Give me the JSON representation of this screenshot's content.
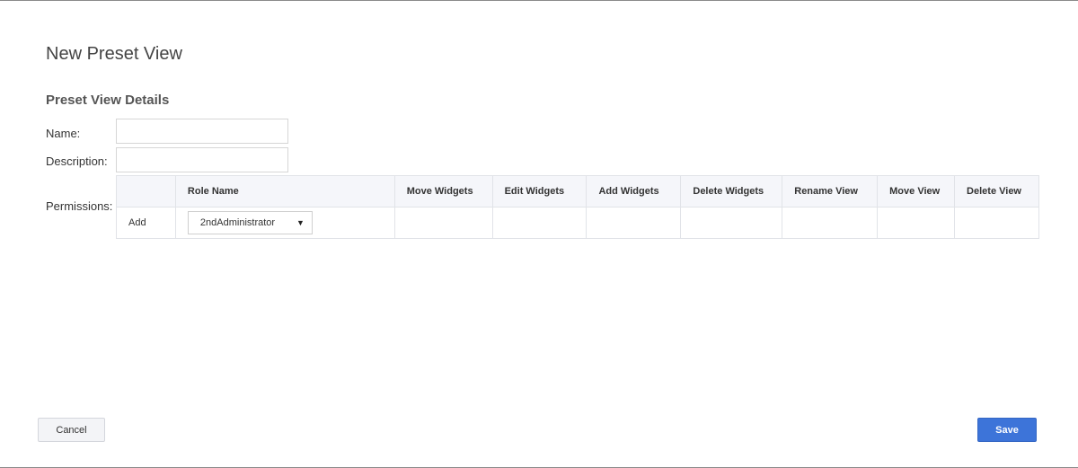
{
  "dialog": {
    "title": "New Preset View",
    "section_title": "Preset View Details"
  },
  "form": {
    "name_label": "Name:",
    "name_value": "",
    "description_label": "Description:",
    "description_value": "",
    "permissions_label": "Permissions:"
  },
  "permissions_table": {
    "columns": [
      "",
      "Role Name",
      "Move Widgets",
      "Edit Widgets",
      "Add Widgets",
      "Delete Widgets",
      "Rename View",
      "Move View",
      "Delete View"
    ],
    "add_row": {
      "add_label": "Add",
      "role_selected": "2ndAdministrator",
      "dropdown_icon": "caret-down-icon"
    }
  },
  "buttons": {
    "cancel": "Cancel",
    "save": "Save"
  },
  "colors": {
    "primary": "#3d74d9",
    "header_bg": "#f5f6fa",
    "border": "#e1e3e8"
  }
}
